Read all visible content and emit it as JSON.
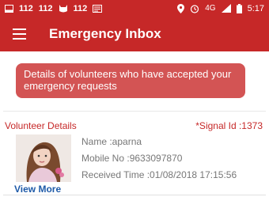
{
  "status_bar": {
    "left_items": [
      "112",
      "112",
      "112"
    ],
    "network": "4G",
    "time": "5:17"
  },
  "app_bar": {
    "title": "Emergency Inbox"
  },
  "banner": {
    "text": "Details of volunteers who have accepted your emergency requests"
  },
  "card": {
    "header_left": "Volunteer Details",
    "header_right": "*Signal Id :1373",
    "name": "Name :aparna",
    "mobile": "Mobile No :9633097870",
    "received": "Received Time :01/08/2018 17:15:56",
    "view_more": "View More"
  },
  "colors": {
    "primary": "#c62828",
    "banner": "#d35454",
    "link": "#1e5aa8"
  }
}
